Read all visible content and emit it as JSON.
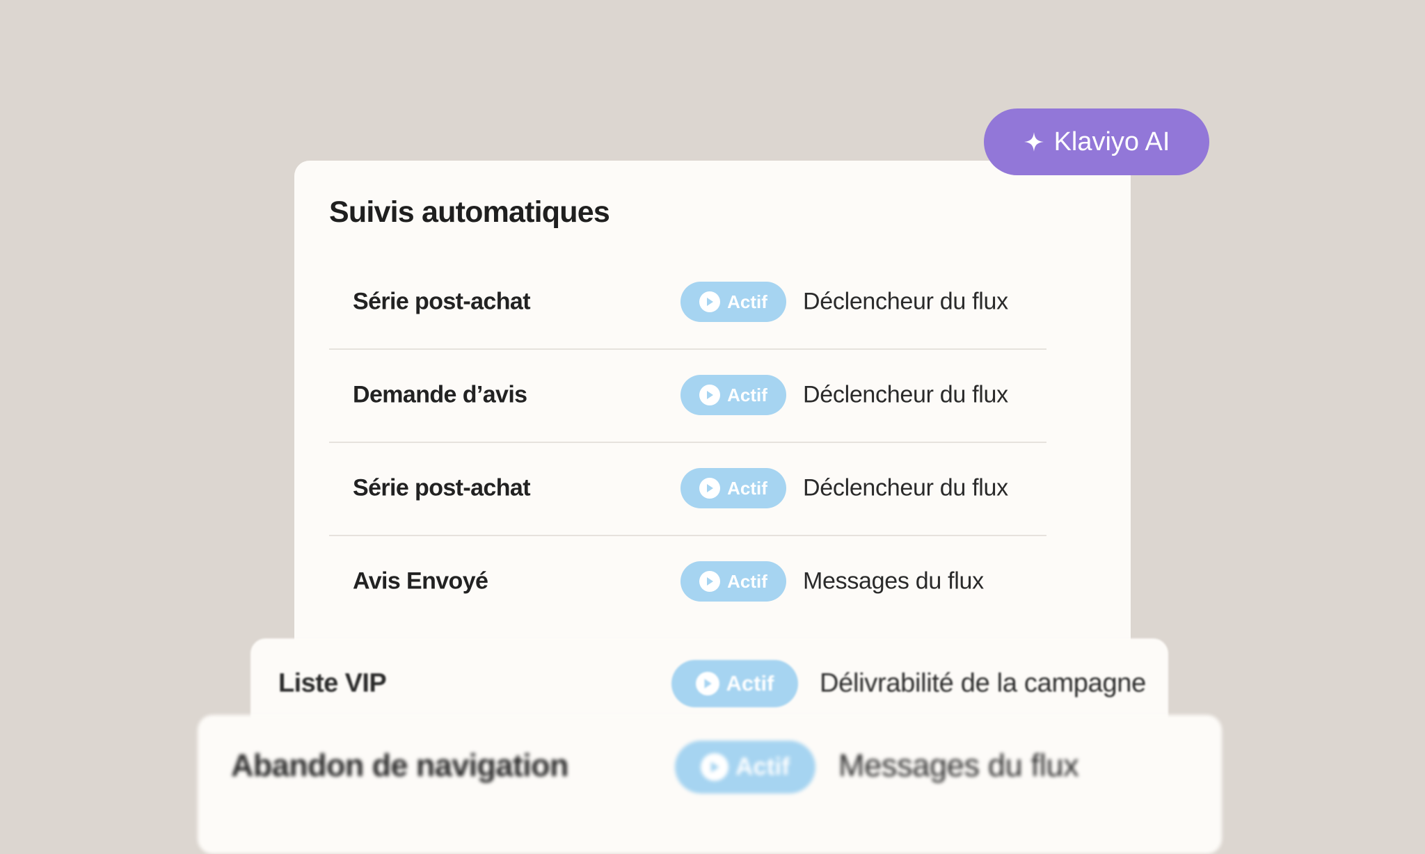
{
  "ai_button": {
    "label": "Klaviyo AI",
    "icon": "sparkle-icon",
    "color": "#9277d8"
  },
  "panel": {
    "title": "Suivis automatiques",
    "rows": [
      {
        "name": "Série post-achat",
        "status": "Actif",
        "detail": "Déclencheur du flux"
      },
      {
        "name": "Demande d’avis",
        "status": "Actif",
        "detail": "Déclencheur du flux"
      },
      {
        "name": "Série post-achat",
        "status": "Actif",
        "detail": "Déclencheur du flux"
      },
      {
        "name": "Avis Envoyé",
        "status": "Actif",
        "detail": "Messages du flux"
      }
    ]
  },
  "background_cards": [
    {
      "name": "Liste VIP",
      "status": "Actif",
      "detail": "Délivrabilité de la campagne"
    },
    {
      "name": "Abandon de navigation",
      "status": "Actif",
      "detail": "Messages du flux"
    }
  ],
  "colors": {
    "background": "#dcd6d0",
    "card": "#fdfbf8",
    "status_badge": "#a6d4f1",
    "accent": "#9277d8"
  }
}
